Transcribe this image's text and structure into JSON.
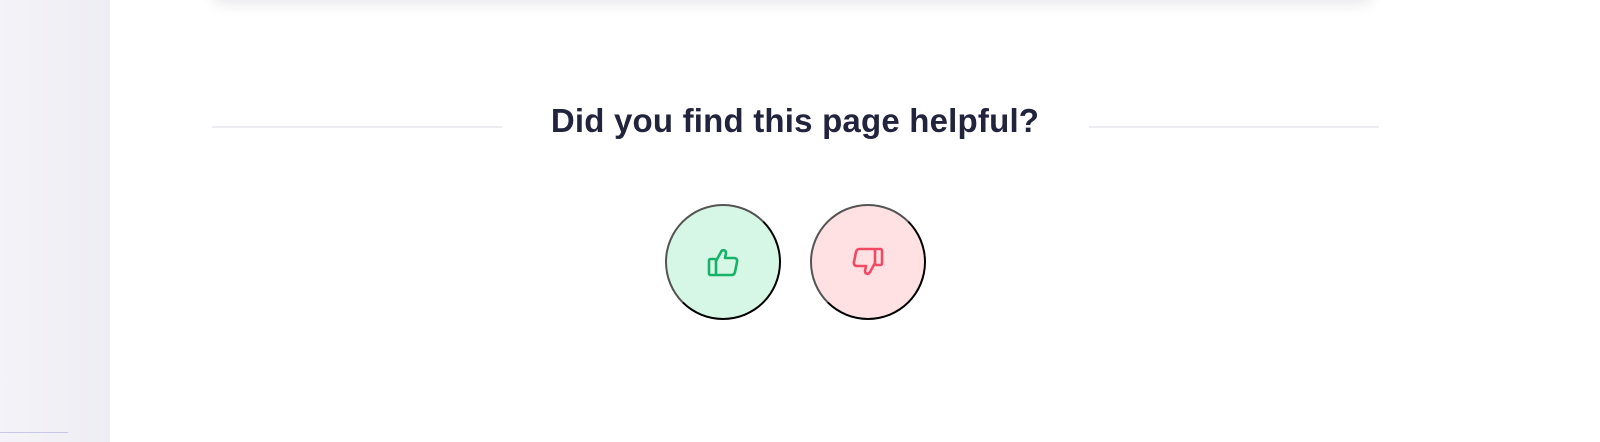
{
  "feedback": {
    "question": "Did you find this page helpful?",
    "buttons": [
      {
        "name": "thumbs-up",
        "icon": "thumbs-up-icon",
        "color": "#17b26a",
        "background": "#d6f7e5"
      },
      {
        "name": "thumbs-down",
        "icon": "thumbs-down-icon",
        "color": "#f04b63",
        "background": "#ffe1e4"
      }
    ]
  },
  "colors": {
    "heading": "#22233d",
    "sidebar": "#f4f3f8",
    "divider": "#ecedf1"
  }
}
